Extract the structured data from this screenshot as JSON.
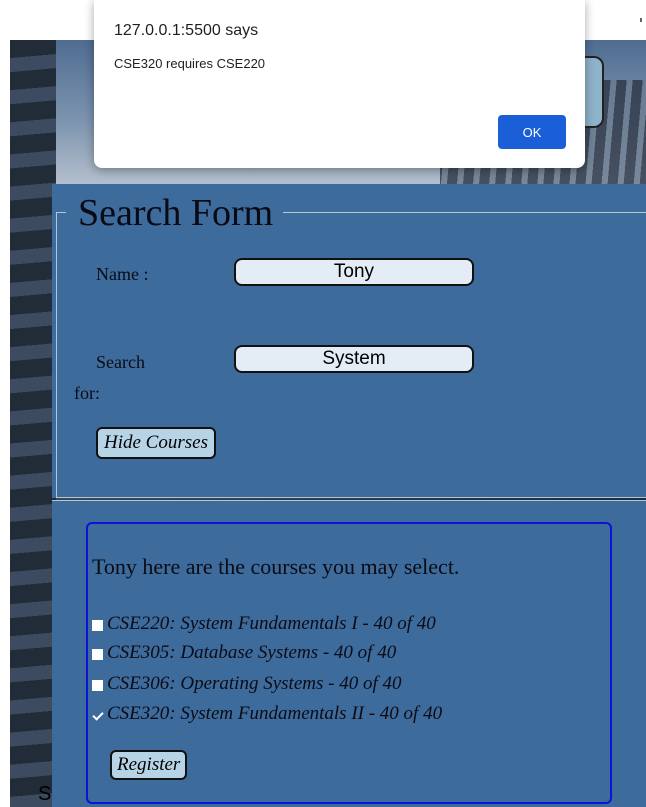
{
  "alert": {
    "title": "127.0.0.1:5500 says",
    "message": "CSE320 requires CSE220",
    "ok_label": "OK"
  },
  "form": {
    "legend": "Search Form",
    "name_label": "Name :",
    "name_value": "Tony",
    "search_label_line1": "Search",
    "search_label_line2": "for:",
    "search_value": "System",
    "hide_courses_label": "Hide Courses"
  },
  "courses": {
    "heading": "Tony here are the courses you may select.",
    "items": [
      {
        "label": "CSE220: System Fundamentals I - 40 of 40",
        "checked": false
      },
      {
        "label": "CSE305: Database Systems - 40 of 40",
        "checked": false
      },
      {
        "label": "CSE306: Operating Systems - 40 of 40",
        "checked": false
      },
      {
        "label": "CSE320: System Fundamentals II - 40 of 40",
        "checked": true
      }
    ],
    "register_label": "Register"
  },
  "stray_text": "S"
}
